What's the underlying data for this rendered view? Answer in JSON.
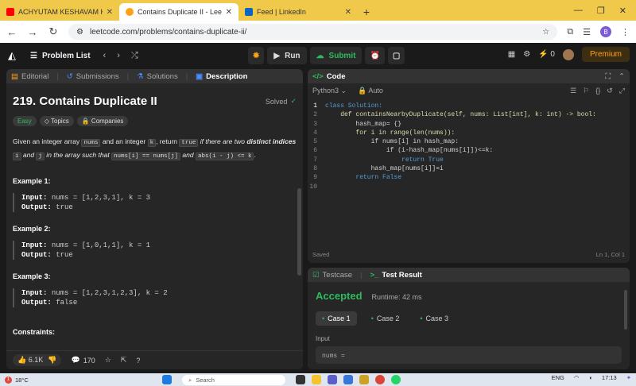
{
  "browser": {
    "tabs": [
      {
        "title": "ACHYUTAM KESHAVAM KRISHNA",
        "color": "#ff0000"
      },
      {
        "title": "Contains Duplicate II - LeetCode",
        "color": "#ffa116"
      },
      {
        "title": "Feed | LinkedIn",
        "color": "#0a66c2"
      }
    ],
    "url": "leetcode.com/problems/contains-duplicate-ii/",
    "profile_initial": "B"
  },
  "nav": {
    "problem_list": "Problem List",
    "run": "Run",
    "submit": "Submit",
    "streak": "0",
    "premium": "Premium"
  },
  "left_tabs": {
    "editorial": "Editorial",
    "submissions": "Submissions",
    "solutions": "Solutions",
    "description": "Description"
  },
  "problem": {
    "title": "219. Contains Duplicate II",
    "solved": "Solved",
    "tags": {
      "difficulty": "Easy",
      "topics": "Topics",
      "companies": "Companies"
    },
    "desc_parts": {
      "p1": "Given an integer array ",
      "c1": "nums",
      "p2": " and an integer ",
      "c2": "k",
      "p3": ", return ",
      "c3": "true",
      "p4": " if there are two ",
      "b1": "distinct indices",
      "p5": " ",
      "c4": "i",
      "p6": " and ",
      "c5": "j",
      "p7": " in the array such that ",
      "c6": "nums[i] == nums[j]",
      "p8": " and ",
      "c7": "abs(i - j) <= k",
      "p9": "."
    },
    "examples": [
      {
        "title": "Example 1:",
        "input": "nums = [1,2,3,1], k = 3",
        "output": "true"
      },
      {
        "title": "Example 2:",
        "input": "nums = [1,0,1,1], k = 1",
        "output": "true"
      },
      {
        "title": "Example 3:",
        "input": "nums = [1,2,3,1,2,3], k = 2",
        "output": "false"
      }
    ],
    "input_label": "Input:",
    "output_label": "Output:",
    "constraints": "Constraints:",
    "likes": "6.1K",
    "comments": "170"
  },
  "code": {
    "header": "Code",
    "language": "Python3",
    "mode": "Auto",
    "lines": [
      "class Solution:",
      "    def containsNearbyDuplicate(self, nums: List[int], k: int) -> bool:",
      "        hash_map= {}",
      "        for i in range(len(nums)):",
      "            if nums[i] in hash_map:",
      "                if (i-hash_map[nums[i]])<=k:",
      "                    return True",
      "            hash_map[nums[i]]=i",
      "        return False",
      ""
    ],
    "line_numbers": [
      "1",
      "2",
      "3",
      "4",
      "5",
      "6",
      "7",
      "8",
      "9",
      "10"
    ],
    "saved": "Saved",
    "position": "Ln 1, Col 1"
  },
  "test": {
    "testcase_tab": "Testcase",
    "result_tab": "Test Result",
    "status": "Accepted",
    "runtime": "Runtime: 42 ms",
    "cases": [
      "Case 1",
      "Case 2",
      "Case 3"
    ],
    "input_label": "Input",
    "input_value": "nums ="
  },
  "taskbar": {
    "temp": "18°C",
    "badge": "1",
    "search": "Search",
    "lang": "ENG",
    "time": "17:13"
  }
}
